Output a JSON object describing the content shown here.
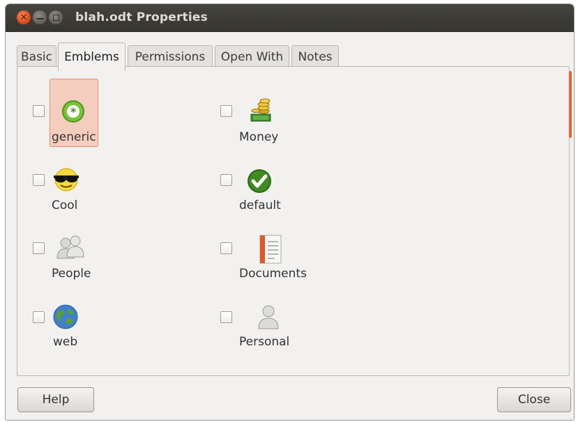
{
  "window": {
    "title": "blah.odt Properties"
  },
  "tabs": [
    "Basic",
    "Emblems",
    "Permissions",
    "Open With",
    "Notes"
  ],
  "active_tab": "Emblems",
  "emblems": [
    {
      "label": "generic",
      "icon": "generic-emblem-icon",
      "checked": false,
      "selected": true
    },
    {
      "label": "Money",
      "icon": "money-emblem-icon",
      "checked": false,
      "selected": false
    },
    {
      "label": "Cool",
      "icon": "cool-emblem-icon",
      "checked": false,
      "selected": false
    },
    {
      "label": "default",
      "icon": "default-emblem-icon",
      "checked": false,
      "selected": false
    },
    {
      "label": "People",
      "icon": "people-emblem-icon",
      "checked": false,
      "selected": false
    },
    {
      "label": "Documents",
      "icon": "documents-emblem-icon",
      "checked": false,
      "selected": false
    },
    {
      "label": "web",
      "icon": "web-emblem-icon",
      "checked": false,
      "selected": false
    },
    {
      "label": "Personal",
      "icon": "personal-emblem-icon",
      "checked": false,
      "selected": false
    }
  ],
  "buttons": {
    "help": "Help",
    "close": "Close"
  },
  "colors": {
    "titlebar": "#3c3b37",
    "accent": "#e5642d",
    "selection": "#f5cdbf"
  }
}
